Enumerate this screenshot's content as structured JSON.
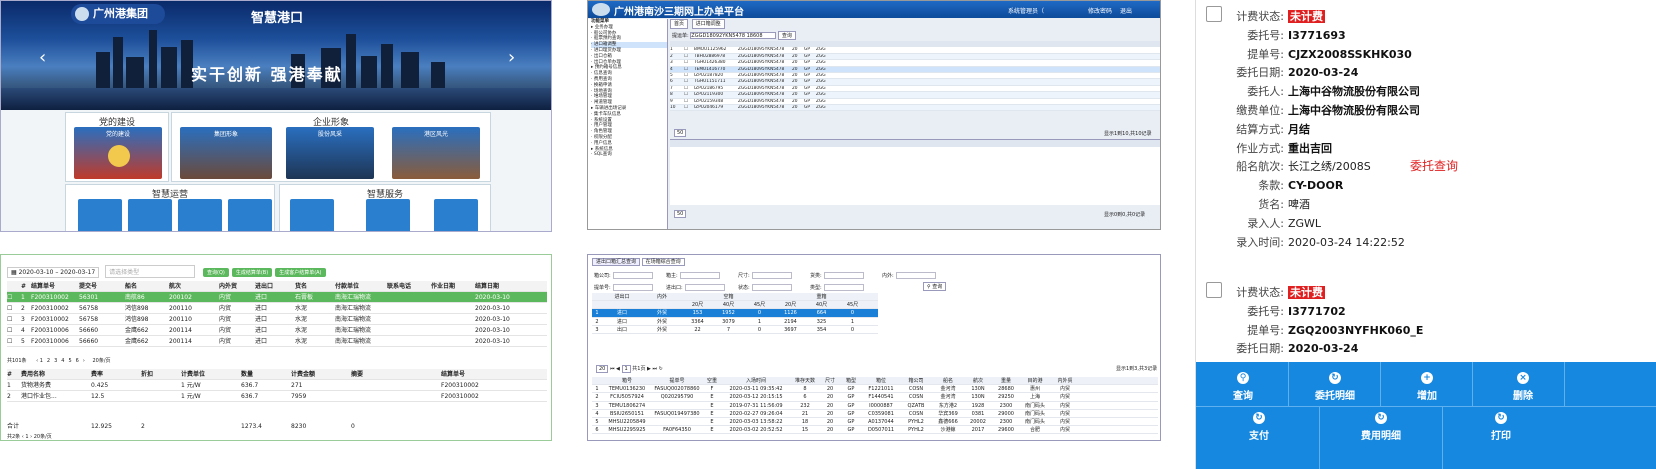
{
  "portal": {
    "logo": "广州港集团",
    "logo_sub": "GUANGZHOU PORT GROUP",
    "title": "智慧港口",
    "slogan": "实干创新  强港奉献",
    "sections": [
      {
        "title": "党的建设",
        "cards": [
          "党的建设"
        ]
      },
      {
        "title": "企业形象",
        "cards": [
          "集团形象",
          "股份风采",
          "港区风光"
        ]
      },
      {
        "title": "智慧运营",
        "cards": [
          "",
          "",
          "",
          ""
        ]
      },
      {
        "title": "智慧服务",
        "cards": [
          "",
          "",
          ""
        ]
      }
    ]
  },
  "platform": {
    "title": "广州港南沙三期网上办单平台",
    "user": "系统管理员（",
    "logout": "退出",
    "pwd": "修改密码",
    "tabs": [
      "功能菜单",
      "首页",
      "进口箱调整"
    ],
    "tree": [
      "业务办理",
      "船公司协办",
      "船票预约查询",
      "进口箱调整",
      "进口理货办理",
      "出口仓箱",
      "出口仓单办理",
      "预约箱号信息",
      "信息查询",
      "费用查询",
      "换箱申请",
      "场地查询",
      "堆场管理",
      "闸道管理",
      "车辆进出场记录",
      "集卡车队信息",
      "系统设置",
      "用户管理",
      "角色管理",
      "权限分配",
      "用户信息",
      "系统信息",
      "SQL查询"
    ],
    "search_label": "提运单:",
    "search_value": "ZGGD18092YKN5478 18608",
    "query": "查询",
    "rows": [
      [
        "1",
        "BMOU1125962",
        "ZGGD18095YKN5478",
        "20",
        "GP",
        "ZGG"
      ],
      [
        "2",
        "TBHU2886978",
        "ZGGD18095YKN5478",
        "20",
        "GP",
        "ZGG"
      ],
      [
        "3",
        "TGHU1426380",
        "ZGGD18095YKN5478",
        "20",
        "GP",
        "ZGG"
      ],
      [
        "4",
        "TEMU1416770",
        "ZGGD18095YKN5478",
        "20",
        "GP",
        "ZGG"
      ],
      [
        "5",
        "IZPU2187820",
        "ZGGD18095YKN5478",
        "20",
        "GP",
        "ZGG"
      ],
      [
        "6",
        "TGHU1151711",
        "ZGGD18095YKN5478",
        "20",
        "GP",
        "ZGG"
      ],
      [
        "7",
        "IZPU2186795",
        "ZGGD18095YKN5478",
        "20",
        "GP",
        "ZGG"
      ],
      [
        "8",
        "IZPU2119300",
        "ZGGD18095YKN5478",
        "20",
        "GP",
        "ZGG"
      ],
      [
        "9",
        "IZPU2159348",
        "ZGGD18095YKN5478",
        "20",
        "GP",
        "ZGG"
      ],
      [
        "10",
        "IZPU2046179",
        "ZGGD18095YKN5478",
        "20",
        "GP",
        "ZGG"
      ]
    ],
    "pager": "50",
    "pager_info": "显示1到10,共10记录",
    "pager2_info": "显示0到0,共0记录"
  },
  "records": [
    {
      "fields": [
        {
          "k": "计费状态:",
          "v": "未计费",
          "badge": true
        },
        {
          "k": "委托号:",
          "v": "I3771693",
          "bold": true
        },
        {
          "k": "提单号:",
          "v": "CJZX2008SSKHK030",
          "bold": true
        },
        {
          "k": "委托日期:",
          "v": "2020-03-24",
          "bold": true
        },
        {
          "k": "委托人:",
          "v": "上海中谷物流股份有限公司",
          "bold": true
        },
        {
          "k": "缴费单位:",
          "v": "上海中谷物流股份有限公司",
          "bold": true
        },
        {
          "k": "结算方式:",
          "v": "月结",
          "bold": true
        },
        {
          "k": "作业方式:",
          "v": "重出吉回",
          "bold": true
        },
        {
          "k": "船名航次:",
          "v": "长江之绣/2008S",
          "bold": false
        },
        {
          "k": "条款:",
          "v": "CY-DOOR",
          "bold": true
        },
        {
          "k": "货名:",
          "v": "啤酒",
          "bold": false
        },
        {
          "k": "录入人:",
          "v": "ZGWL",
          "bold": false
        },
        {
          "k": "录入时间:",
          "v": "2020-03-24 14:22:52",
          "bold": false
        }
      ]
    },
    {
      "fields": [
        {
          "k": "计费状态:",
          "v": "未计费",
          "badge": true
        },
        {
          "k": "委托号:",
          "v": "I3771702",
          "bold": true
        },
        {
          "k": "提单号:",
          "v": "ZGQ2003NYFHK060_E",
          "bold": true
        },
        {
          "k": "委托日期:",
          "v": "2020-03-24",
          "bold": true
        }
      ]
    }
  ],
  "overlay_label": "委托查询",
  "actions_row1": [
    "查询",
    "委托明细",
    "增加",
    "删除"
  ],
  "actions_row2": [
    "支付",
    "费用明细",
    "打印"
  ],
  "billing": {
    "date_from": "2020-03-10",
    "date_to": "2020-03-17",
    "search_placeholder": "请选择类型",
    "buttons": [
      "查询(Q)",
      "生成结算单(B)",
      "生成客户结算单(A)"
    ],
    "headers": [
      "#",
      "结算单号",
      "提交号",
      "船名",
      "航次",
      "内外贸",
      "进出口",
      "货名",
      "付款单位",
      "联系电话",
      "作业日期",
      "结算日期"
    ],
    "rows": [
      [
        "1",
        "F200310002",
        "56301",
        "南航86",
        "200102",
        "内贸",
        "进口",
        "石膏板",
        "南海汇瑞物流",
        "",
        "",
        "2020-03-10"
      ],
      [
        "2",
        "F200310002",
        "56758",
        "鸿信898",
        "200110",
        "内贸",
        "进口",
        "水泥",
        "南海汇瑞物流",
        "",
        "",
        "2020-03-10"
      ],
      [
        "3",
        "F200310002",
        "56758",
        "鸿信898",
        "200110",
        "内贸",
        "进口",
        "水泥",
        "南海汇瑞物流",
        "",
        "",
        "2020-03-10"
      ],
      [
        "4",
        "F200310006",
        "56660",
        "金鹰662",
        "200114",
        "内贸",
        "进口",
        "水泥",
        "南海汇瑞物流",
        "",
        "",
        "2020-03-10"
      ],
      [
        "5",
        "F200310006",
        "56660",
        "金鹰662",
        "200114",
        "内贸",
        "进口",
        "水泥",
        "南海汇瑞物流",
        "",
        "",
        "2020-03-10"
      ]
    ],
    "pager": "共101条",
    "pages": [
      "1",
      "2",
      "3",
      "4",
      "5",
      "6"
    ],
    "per_page": "20条/页",
    "sub_headers": [
      "#",
      "费用名称",
      "费率",
      "折扣",
      "计费单位",
      "数量",
      "计费金额",
      "摘要",
      "结算单号"
    ],
    "sub_rows": [
      [
        "1",
        "货物港务费",
        "0.425",
        "",
        "1 元/W",
        "636.7",
        "271",
        "",
        "F200310002"
      ],
      [
        "2",
        "港口作业包...",
        "12.5",
        "",
        "1 元/W",
        "636.7",
        "7959",
        "",
        "F200310002"
      ]
    ],
    "total": [
      "合计",
      "12.925",
      "2",
      "",
      "1273.4",
      "8230",
      "0",
      ""
    ],
    "sub_pager": "共2条",
    "sub_per_page": "20条/页"
  },
  "stats": {
    "tabs": [
      "进出口箱汇总查询",
      "在场箱综合查询"
    ],
    "filters": [
      "箱公司",
      "箱主",
      "尺寸",
      "货类",
      "内外",
      "提单号",
      "进出口",
      "状态",
      "类型"
    ],
    "query": "查询",
    "group_headers": [
      "进出口",
      "内外",
      "空箱",
      "重箱"
    ],
    "sub_headers": [
      "20尺",
      "40尺",
      "45尺",
      "20尺",
      "40尺",
      "45尺"
    ],
    "rows": [
      [
        "1",
        "进口",
        "外贸",
        "153",
        "1952",
        "0",
        "1126",
        "664",
        "0"
      ],
      [
        "2",
        "进口",
        "外贸",
        "3364",
        "3079",
        "1",
        "2194",
        "325",
        "1"
      ],
      [
        "3",
        "出口",
        "外贸",
        "22",
        "7",
        "0",
        "3697",
        "354",
        "0"
      ]
    ],
    "pager_size": "20",
    "pager_page": "1",
    "pager_of": "共1页",
    "pager_info": "显示1到3,共3记录",
    "detail_headers": [
      "箱号",
      "提单号",
      "空重",
      "入场时间",
      "堆存天数",
      "尺寸",
      "箱型",
      "箱位",
      "箱公司",
      "船名",
      "航次",
      "重量",
      "目的港",
      "内外贸"
    ],
    "detail_rows": [
      [
        "TEMU0136230",
        "FASUQ002078860",
        "F",
        "2020-03-11 09:35:42",
        "8",
        "20",
        "GP",
        "F1221011",
        "COSN",
        "金河湾",
        "130N",
        "28680",
        "惠州",
        "内贸"
      ],
      [
        "FCIU5057924",
        "Q020295790",
        "E",
        "2020-03-12 20:15:15",
        "6",
        "20",
        "GP",
        "F1440541",
        "COSN",
        "金河湾",
        "130N",
        "29250",
        "上海",
        "内贸"
      ],
      [
        "TEMU1806274",
        "",
        "E",
        "2019-07-31 11:56:09",
        "232",
        "20",
        "GP",
        "I0000887",
        "QZATB",
        "东方港2",
        "1928",
        "2300",
        "南门码头",
        "内贸"
      ],
      [
        "BSIU2650151",
        "FASUQ019497380",
        "E",
        "2020-02-27 09:26:04",
        "21",
        "20",
        "GP",
        "C0359081",
        "COSN",
        "华宾369",
        "0381",
        "29000",
        "南门码头",
        "内贸"
      ],
      [
        "MHSU2205849",
        "",
        "E",
        "2020-03-03 13:58:22",
        "18",
        "20",
        "GP",
        "A0137044",
        "PYHL2",
        "鑫德666",
        "20002",
        "2300",
        "南门码头",
        "内贸"
      ],
      [
        "MHSU2295925",
        "FA0F64350",
        "E",
        "2020-03-02 20:52:52",
        "15",
        "20",
        "GP",
        "D0507011",
        "PYHL2",
        "沙港鲸",
        "2017",
        "29600",
        "合肥",
        "内贸"
      ]
    ]
  }
}
